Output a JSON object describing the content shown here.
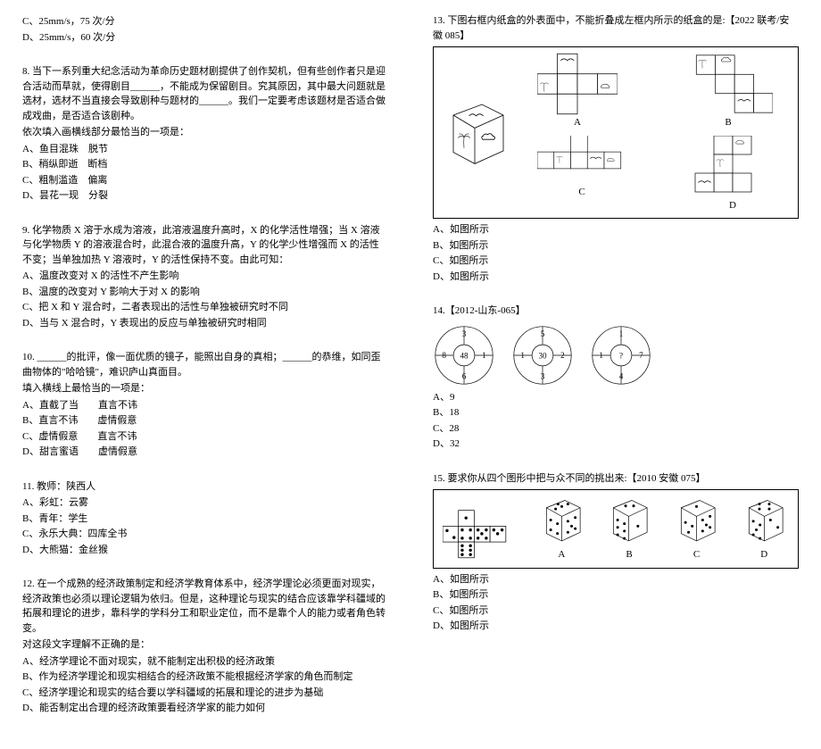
{
  "q7_opts": {
    "c": "C、25mm/s，75 次/分",
    "d": "D、25mm/s，60 次/分"
  },
  "q8": {
    "stem": "8. 当下一系列重大纪念活动为革命历史题材剧提供了创作契机，但有些创作者只是迎合活动而草就，使得剧目______，不能成为保留剧目。究其原因，其中最大问题就是选材，选材不当直接会导致剧种与题材的______。我们一定要考虑该题材是否适合做成戏曲，是否适合该剧种。",
    "prompt": "依次填入画横线部分最恰当的一项是：",
    "a": "A、鱼目混珠　脱节",
    "b": "B、稍纵即逝　断档",
    "c": "C、粗制滥造　偏离",
    "d": "D、昙花一现　分裂"
  },
  "q9": {
    "stem": "9. 化学物质 X 溶于水成为溶液，此溶液温度升高时，X 的化学活性增强；当 X 溶液与化学物质 Y 的溶液混合时，此混合液的温度升高，Y 的化学少性增强而 X 的活性不变；当单独加热 Y 溶液时，Y 的活性保持不变。由此可知：",
    "a": "A、温度改变对 X 的活性不产生影响",
    "b": "B、温度的改变对 Y 影响大于对 X 的影响",
    "c": "C、把 X 和 Y 混合时，二者表现出的活性与单独被研究时不同",
    "d": "D、当与 X 混合时，Y 表现出的反应与单独被研究时相同"
  },
  "q10": {
    "stem": "10. ______的批评，像一面优质的镜子，能照出自身的真相；______的恭维，如同歪曲物体的\"哈哈镜\"，难识庐山真面目。",
    "prompt": "填入横线上最恰当的一项是：",
    "a": "A、直截了当　　直言不讳",
    "b": "B、直言不讳　　虚情假意",
    "c": "C、虚情假意　　直言不讳",
    "d": "D、甜言蜜语　　虚情假意"
  },
  "q11": {
    "stem": "11. 教师：陕西人",
    "a": "A、彩虹：云雾",
    "b": "B、青年：学生",
    "c": "C、永乐大典：四库全书",
    "d": "D、大熊猫：金丝猴"
  },
  "q12": {
    "stem": "12. 在一个成熟的经济政策制定和经济学教育体系中，经济学理论必须更面对现实，经济政策也必须以理论逻辑为依归。但是，这种理论与现实的结合应该靠学科疆域的拓展和理论的进步，靠科学的学科分工和职业定位，而不是靠个人的能力或者角色转变。",
    "prompt": "对这段文字理解不正确的是：",
    "a": "A、经济学理论不面对现实，就不能制定出积极的经济政策",
    "b": "B、作为经济学理论和现实相结合的经济政策不能根据经济学家的角色而制定",
    "c": "C、经济学理论和现实的结合要以学科疆域的拓展和理论的进步为基础",
    "d": "D、能否制定出合理的经济政策要看经济学家的能力如何"
  },
  "q13": {
    "stem": "13. 下图右框内纸盒的外表面中，不能折叠成左框内所示的纸盒的是:【2022 联考/安徽 085】",
    "labels": {
      "a": "A",
      "b": "B",
      "c": "C",
      "d": "D"
    },
    "a": "A、如图所示",
    "b": "B、如图所示",
    "c": "C、如图所示",
    "d": "D、如图所示"
  },
  "q14": {
    "stem": "14.【2012-山东-065】",
    "a": "A、9",
    "b": "B、18",
    "c": "C、28",
    "d": "D、32"
  },
  "q15": {
    "stem": "15. 要求你从四个图形中把与众不同的挑出来:【2010 安徽 075】",
    "labels": {
      "a": "A",
      "b": "B",
      "c": "C",
      "d": "D"
    },
    "a": "A、如图所示",
    "b": "B、如图所示",
    "c": "C、如图所示",
    "d": "D、如图所示"
  },
  "chart_data": [
    {
      "type": "table",
      "title": "Q14 circle 1 sectors (left)",
      "categories": [
        "top",
        "right",
        "bottom",
        "left",
        "center"
      ],
      "values": [
        3,
        1,
        6,
        8,
        48
      ]
    },
    {
      "type": "table",
      "title": "Q14 circle 2 sectors (middle)",
      "categories": [
        "top",
        "right",
        "bottom",
        "left",
        "center"
      ],
      "values": [
        5,
        2,
        3,
        1,
        30
      ]
    },
    {
      "type": "table",
      "title": "Q14 circle 3 sectors (right)",
      "categories": [
        "top",
        "right",
        "bottom",
        "left",
        "center"
      ],
      "values": [
        1,
        7,
        4,
        1,
        "?"
      ]
    }
  ]
}
